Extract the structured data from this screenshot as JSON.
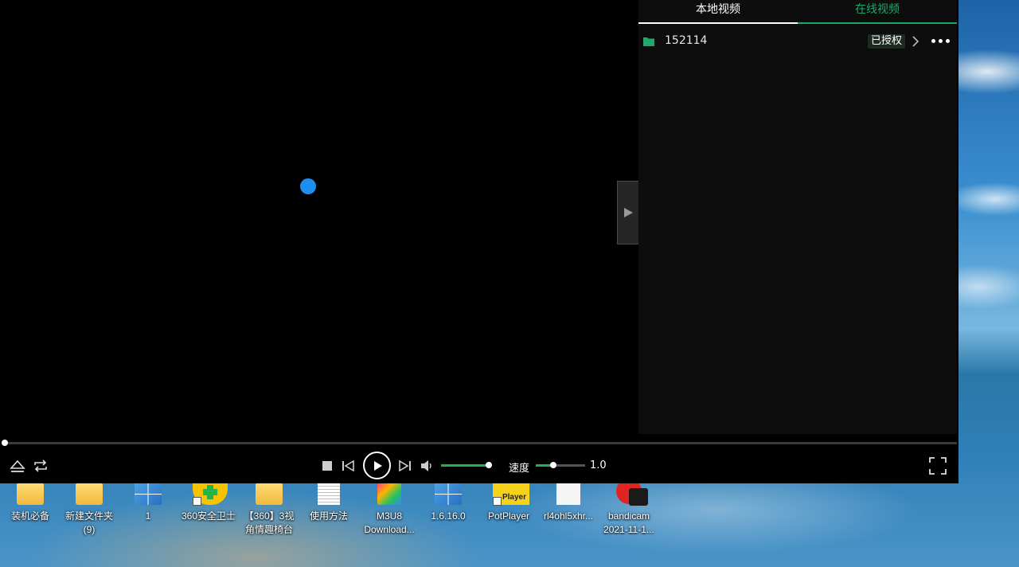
{
  "playlist": {
    "tabs": [
      {
        "label": "本地视频",
        "active": true
      },
      {
        "label": "在线视频",
        "active": false
      }
    ],
    "items": [
      {
        "name": "152114",
        "badge": "已授权"
      }
    ]
  },
  "controls": {
    "speed_label": "速度",
    "speed_value": "1.0",
    "volume_level": 1.0,
    "speed_level": 0.35,
    "progress": 0.0
  },
  "colors": {
    "accent_green": "#1fa86b",
    "slider_green": "#22b14c",
    "loading_blue": "#1e8ff0"
  },
  "desktop": {
    "icons": [
      {
        "label": "装机必备",
        "icon": "folder-icon"
      },
      {
        "label": "新建文件夹\n(9)",
        "icon": "folder-icon"
      },
      {
        "label": "1",
        "icon": "cube-icon"
      },
      {
        "label": "360安全卫士",
        "icon": "360-icon"
      },
      {
        "label": "【360】3视\n角情趣椅台",
        "icon": "folder-icon"
      },
      {
        "label": "使用方法",
        "icon": "document-icon"
      },
      {
        "label": "M3U8\nDownload...",
        "icon": "m3u8-icon"
      },
      {
        "label": "1.6.16.0",
        "icon": "cube-icon"
      },
      {
        "label": "PotPlayer",
        "icon": "potplayer-icon",
        "graphic_text": "Player"
      },
      {
        "label": "rl4ohl5xhr...",
        "icon": "blank-file-icon"
      },
      {
        "label": "bandicam\n2021-11-1...",
        "icon": "bandicam-icon"
      }
    ]
  }
}
